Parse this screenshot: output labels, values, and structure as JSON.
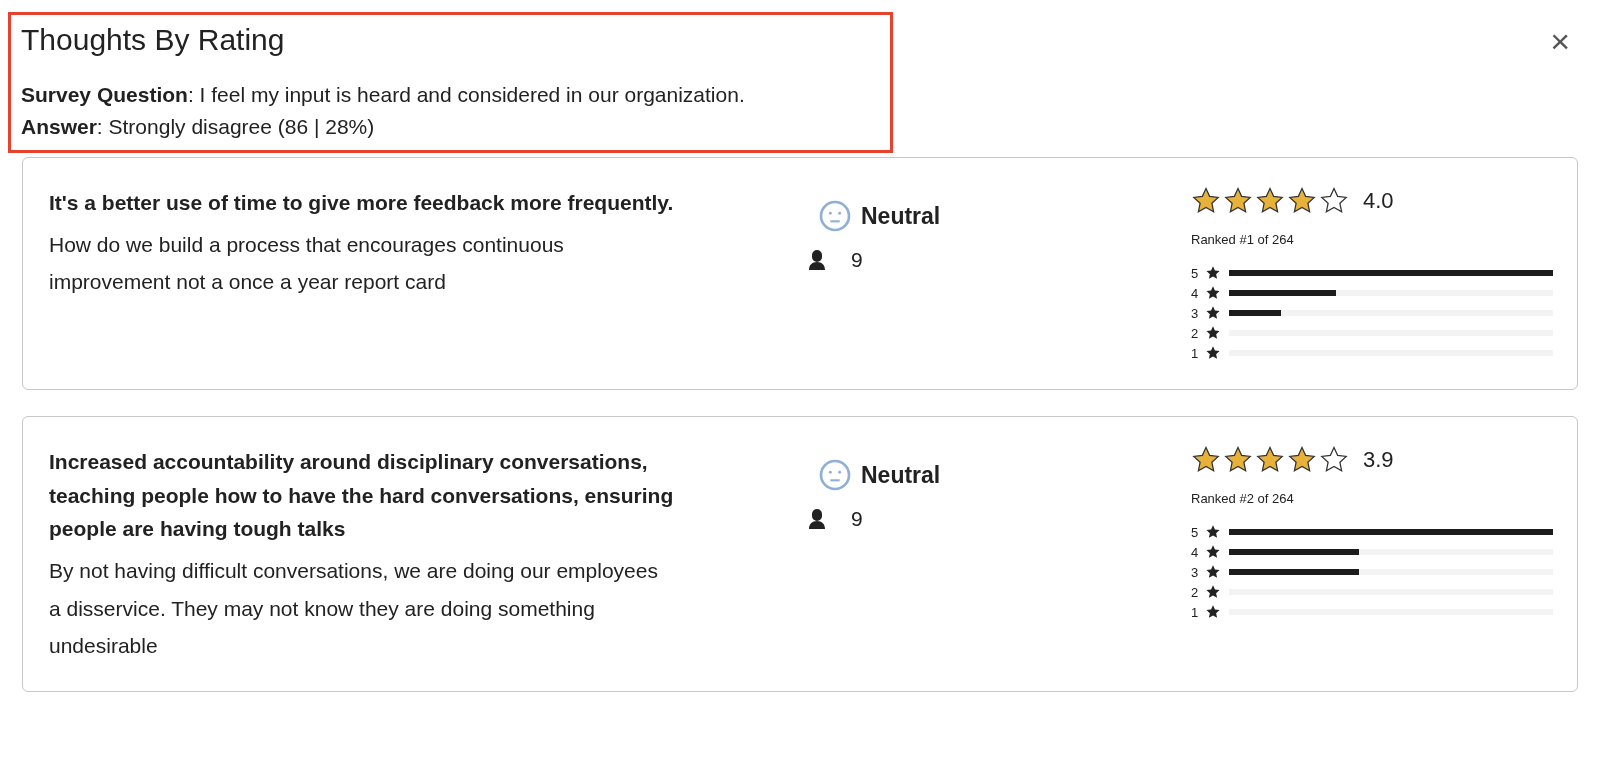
{
  "dialog": {
    "title": "Thoughts By Rating",
    "question": "**Survey Question**: I feel my input is heard and considered in our organization.",
    "answer": "**Answer**: Strongly disagree (86 | 28%)",
    "close": "×"
  },
  "thoughts": [
    {
      "title": "It's a better use of time to give more feedback more frequently.",
      "body": "How do we build a process that encourages continuous improvement not a once a year report card",
      "sentiment": "Neutral",
      "participants": "9",
      "stars": 4,
      "rating": "4.0",
      "rank": "Ranked #1 of 264",
      "distribution": [
        {
          "label": "5",
          "level": 1.0
        },
        {
          "label": "4",
          "level": 0.33
        },
        {
          "label": "3",
          "level": 0.16
        },
        {
          "label": "2"
        },
        {
          "label": "1"
        }
      ]
    },
    {
      "title": "Increased accountability around disciplinary conversations, teaching people how to have the hard conversations, ensuring people are having tough talks",
      "body": "By not having difficult conversations, we are doing our employees a disservice. They may not know they are doing something undesirable",
      "sentiment": "Neutral",
      "participants": "9",
      "stars": 4,
      "rating": "3.9",
      "rank": "Ranked #2 of 264",
      "distribution": [
        {
          "label": "5",
          "level": 1.0
        },
        {
          "label": "4",
          "level": 0.4
        },
        {
          "label": "3",
          "level": 0.4
        },
        {
          "label": "2"
        },
        {
          "label": "1"
        }
      ]
    }
  ]
}
